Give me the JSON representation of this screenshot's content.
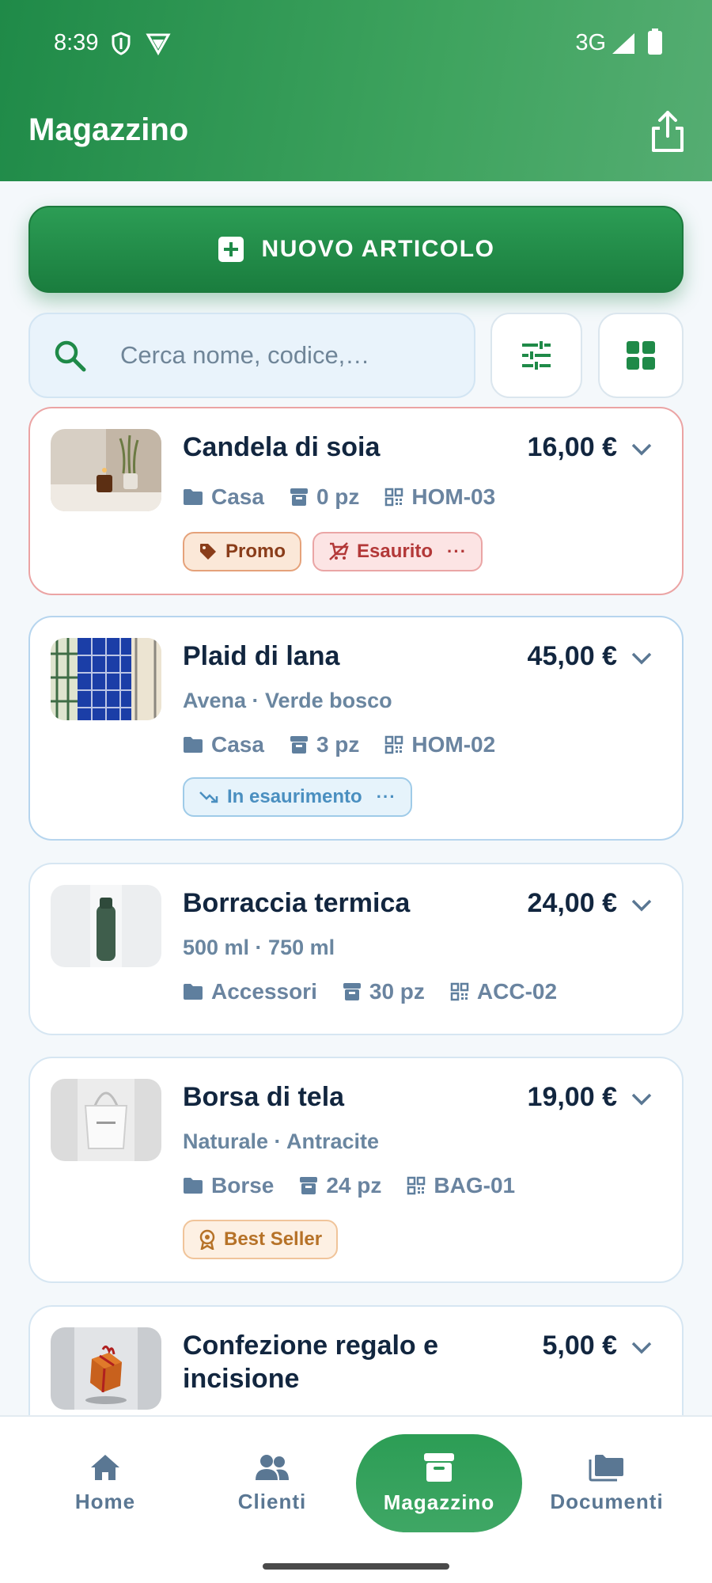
{
  "status_bar": {
    "time": "8:39",
    "network": "3G"
  },
  "header": {
    "title": "Magazzino"
  },
  "actions": {
    "new_item_label": "NUOVO ARTICOLO"
  },
  "search": {
    "placeholder": "Cerca nome, codice,…"
  },
  "colors": {
    "brand_green": "#1f8a48",
    "out_of_stock": "#b33838",
    "low_stock": "#4a8fc0",
    "promo": "#8a3d1a",
    "best_seller": "#b67228"
  },
  "items": [
    {
      "name": "Candela di soia",
      "price": "16,00 €",
      "category": "Casa",
      "stock": "0 pz",
      "code": "HOM-03",
      "tags": {
        "promo": "Promo",
        "status": "Esaurito"
      }
    },
    {
      "name": "Plaid di lana",
      "price": "45,00 €",
      "variants": "Avena · Verde bosco",
      "category": "Casa",
      "stock": "3 pz",
      "code": "HOM-02",
      "tags": {
        "status": "In esaurimento"
      }
    },
    {
      "name": "Borraccia termica",
      "price": "24,00 €",
      "variants": "500 ml · 750 ml",
      "category": "Accessori",
      "stock": "30 pz",
      "code": "ACC-02"
    },
    {
      "name": "Borsa di tela",
      "price": "19,00 €",
      "variants": "Naturale · Antracite",
      "category": "Borse",
      "stock": "24 pz",
      "code": "BAG-01",
      "tags": {
        "best": "Best Seller"
      }
    },
    {
      "name": "Confezione regalo e incisione",
      "price": "5,00 €"
    }
  ],
  "bottom_nav": [
    {
      "label": "Home",
      "icon": "home-icon"
    },
    {
      "label": "Clienti",
      "icon": "people-icon"
    },
    {
      "label": "Magazzino",
      "icon": "archive-icon",
      "active": true
    },
    {
      "label": "Documenti",
      "icon": "folders-icon"
    }
  ]
}
